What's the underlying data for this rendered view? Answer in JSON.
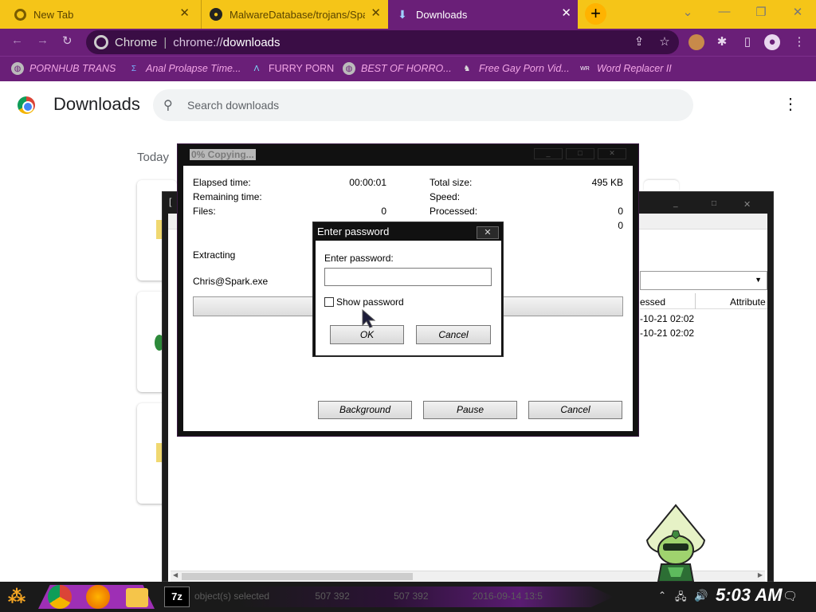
{
  "browser": {
    "tabs": [
      {
        "label": "New Tab"
      },
      {
        "label": "MalwareDatabase/trojans/Spa"
      },
      {
        "label": "Downloads"
      }
    ],
    "address": {
      "chip": "Chrome",
      "scheme": "chrome://",
      "path": "downloads"
    },
    "bookmarks": [
      {
        "label": "PORNHUB TRANS"
      },
      {
        "label": "Anal Prolapse Time..."
      },
      {
        "label": "FURRY PORN"
      },
      {
        "label": "BEST OF HORRO..."
      },
      {
        "label": "Free Gay Porn Vid..."
      },
      {
        "label": "Word Replacer II"
      }
    ],
    "colors": {
      "tabstrip": "#f5c518",
      "toolbar": "#6a1f78"
    }
  },
  "downloads": {
    "title": "Downloads",
    "search_placeholder": "Search downloads",
    "section_today": "Today"
  },
  "copy_dialog": {
    "title": "0% Copying...",
    "elapsed_label": "Elapsed time:",
    "elapsed_value": "00:00:01",
    "remaining_label": "Remaining time:",
    "files_label": "Files:",
    "files_value": "0",
    "total_size_label": "Total size:",
    "total_size_value": "495 KB",
    "speed_label": "Speed:",
    "processed_label": "Processed:",
    "processed_value": "0",
    "extra_value": "0",
    "extracting_label": "Extracting",
    "file_name": "Chris@Spark.exe",
    "progress": 0,
    "buttons": {
      "background": "Background",
      "pause": "Pause",
      "cancel": "Cancel"
    }
  },
  "password_dialog": {
    "title": "Enter password",
    "close": "✕",
    "field_label": "Enter password:",
    "field_value": "",
    "show_password_label": "Show password",
    "show_password_checked": false,
    "ok_label": "OK",
    "cancel_label": "Cancel"
  },
  "file_manager": {
    "col_processed": "essed",
    "col_attributes": "Attribute",
    "rows": [
      {
        "date": "-10-21 02:02"
      },
      {
        "date": "-10-21 02:02"
      }
    ],
    "status": {
      "selected": "object(s) selected",
      "size1": "507 392",
      "size2": "507 392",
      "date": "2016-09-14 13:5"
    }
  },
  "taskbar": {
    "clock": "5:03 AM",
    "apps": [
      "chrome-icon",
      "firefox-icon",
      "file-explorer-icon",
      "7zip-icon"
    ],
    "seven_zip_label": "7z"
  }
}
